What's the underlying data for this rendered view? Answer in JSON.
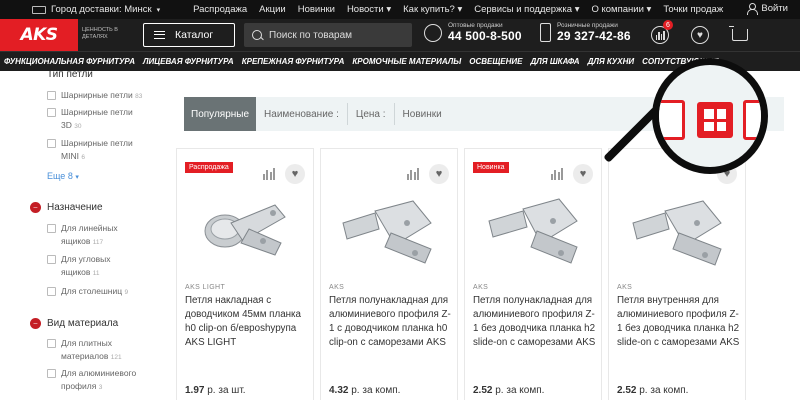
{
  "topbar": {
    "city": "Город доставки: Минск",
    "links": [
      "Распродажа",
      "Акции",
      "Новинки",
      "Новости",
      "Как купить?",
      "Сервисы и поддержка",
      "О компании",
      "Точки продаж"
    ],
    "login": "Войти"
  },
  "header": {
    "logo": "AKS",
    "tagline": "ценность в деталях",
    "catalog_label": "Каталог",
    "search_placeholder": "Поиск по товарам",
    "wholesale_label": "Оптовые продажи",
    "wholesale_phone": "44 500-8-500",
    "retail_label": "Розничные продажи",
    "retail_phone": "29 327-42-86",
    "compare_count": "6"
  },
  "catnav": [
    "ФУНКЦИОНАЛЬНАЯ ФУРНИТУРА",
    "ЛИЦЕВАЯ ФУРНИТУРА",
    "КРЕПЕЖНАЯ ФУРНИТУРА",
    "КРОМОЧНЫЕ МАТЕРИАЛЫ",
    "ОСВЕЩЕНИЕ",
    "ДЛЯ ШКАФА",
    "ДЛЯ КУХНИ",
    "СОПУТСТВУЮЩИЕ"
  ],
  "sidebar": {
    "group1_title": "Тип петли",
    "group1_items": [
      {
        "label": "Шарнирные петли",
        "count": "83"
      },
      {
        "label": "Шарнирные петли 3D",
        "count": "30"
      },
      {
        "label": "Шарнирные петли MINI",
        "count": "6"
      }
    ],
    "more": "Еще 8",
    "group2_title": "Назначение",
    "group2_items": [
      {
        "label": "Для линейных ящиков",
        "count": "117"
      },
      {
        "label": "Для угловых ящиков",
        "count": "11"
      },
      {
        "label": "Для столешниц",
        "count": "9"
      }
    ],
    "group3_title": "Вид материала",
    "group3_items": [
      {
        "label": "Для плитных материалов",
        "count": "121"
      },
      {
        "label": "Для алюминиевого профиля",
        "count": "3"
      }
    ]
  },
  "sortbar": {
    "items": [
      "Популярные",
      "Наименование :",
      "Цена :",
      "Новинки"
    ]
  },
  "products": [
    {
      "tag": "Распродажа",
      "brand": "AKS LIGHT",
      "title": "Петля накладная с доводчиком 45мм планка h0 clip-on б/евроshурупа AKS LIGHT",
      "price": "1.97",
      "unit": "р. за шт."
    },
    {
      "tag": "",
      "brand": "AKS",
      "title": "Петля полунакладная для алюминиевого профиля Z-1 с доводчиком планка h0 clip-on с саморезами AKS",
      "price": "4.32",
      "unit": "р. за комп."
    },
    {
      "tag": "Новинка",
      "brand": "AKS",
      "title": "Петля полунакладная для алюминиевого профиля Z-1 без доводчика планка h2 slide-on с саморезами AKS",
      "price": "2.52",
      "unit": "р. за комп."
    },
    {
      "tag": "",
      "brand": "AKS",
      "title": "Петля внутренняя для алюминиевого профиля Z-1 без доводчика планка h2 slide-on с саморезами AKS",
      "price": "2.52",
      "unit": "р. за комп."
    }
  ],
  "colors": {
    "accent": "#e31e24",
    "dark": "#1e1e1e",
    "sortbar_bg": "#eef3f4"
  }
}
